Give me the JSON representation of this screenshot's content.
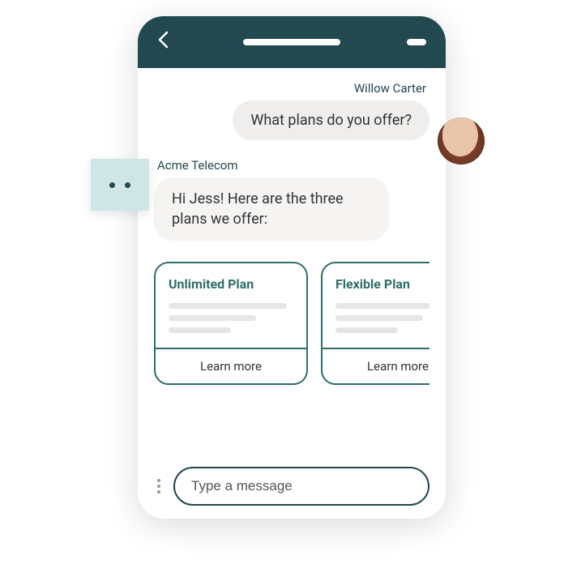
{
  "chat": {
    "user_name": "Willow Carter",
    "user_message": "What plans do you offer?",
    "bot_name": "Acme Telecom",
    "bot_message": "Hi Jess! Here are the three plans we offer:",
    "cards": [
      {
        "title": "Unlimited Plan",
        "cta": "Learn more"
      },
      {
        "title": "Flexible Plan",
        "cta": "Learn more"
      }
    ],
    "input_placeholder": "Type a message"
  }
}
